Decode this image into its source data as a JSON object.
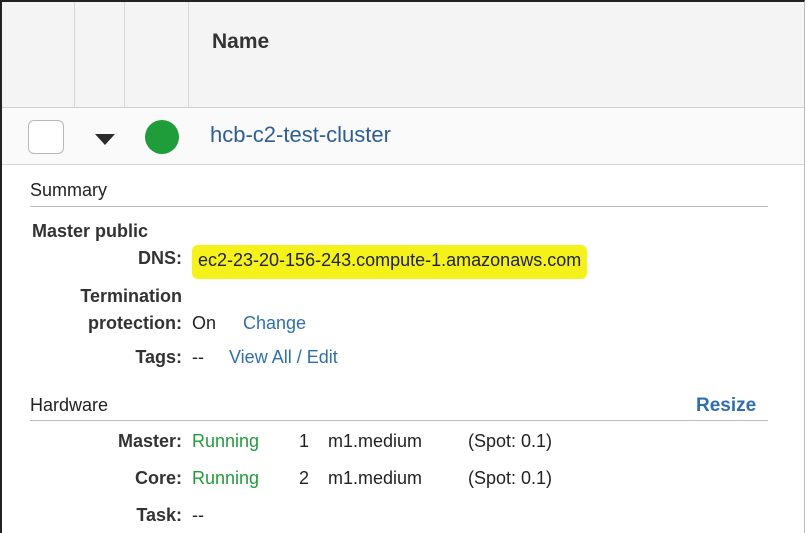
{
  "table": {
    "header_name": "Name"
  },
  "cluster": {
    "name": "hcb-c2-test-cluster",
    "status_color": "#1e9d3a"
  },
  "summary": {
    "title": "Summary",
    "master_dns_label_line1": "Master public",
    "master_dns_label_line2": "DNS:",
    "master_dns_value": "ec2-23-20-156-243.compute-1.amazonaws.com",
    "termination_label_line1": "Termination",
    "termination_label_line2": "protection:",
    "termination_value": "On",
    "termination_change_link": "Change",
    "tags_label": "Tags:",
    "tags_value": "--",
    "tags_link": "View All / Edit"
  },
  "hardware": {
    "title": "Hardware",
    "resize_link": "Resize",
    "rows": [
      {
        "label": "Master:",
        "status": "Running",
        "count": "1",
        "type": "m1.medium",
        "spot": "(Spot: 0.1)"
      },
      {
        "label": "Core:",
        "status": "Running",
        "count": "2",
        "type": "m1.medium",
        "spot": "(Spot: 0.1)"
      },
      {
        "label": "Task:",
        "status": "--"
      }
    ]
  },
  "colors": {
    "link": "#2f6fb0",
    "running": "#239b3a",
    "highlight": "#f4f21a"
  }
}
